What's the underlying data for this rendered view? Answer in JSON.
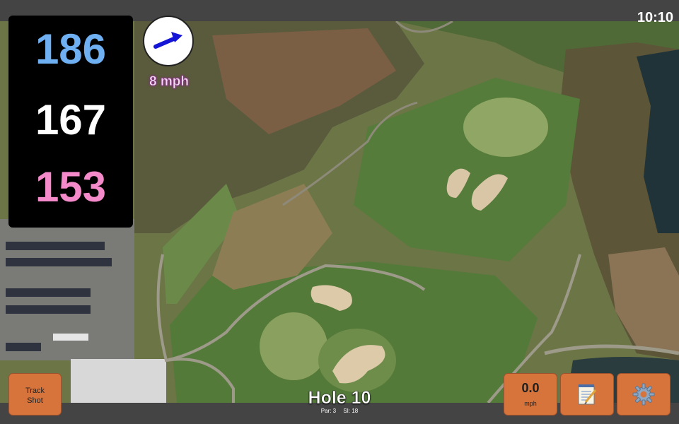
{
  "clock": "10:10",
  "distances": {
    "back": "186",
    "middle": "167",
    "front": "153"
  },
  "wind": {
    "speed": "8 mph",
    "icon": "arrow-icon"
  },
  "hole": {
    "title": "Hole 10",
    "par": "Par: 3",
    "si": "SI: 18"
  },
  "buttons": {
    "track_line1": "Track",
    "track_line2": "Shot",
    "speed_value": "0.0",
    "speed_unit": "mph",
    "notes_icon": "notepad-icon",
    "settings_icon": "gear-icon"
  },
  "colors": {
    "back": "#6fb0f2",
    "middle": "#ffffff",
    "front": "#f48ac9",
    "button": "#d6743c",
    "bar": "#444444"
  }
}
